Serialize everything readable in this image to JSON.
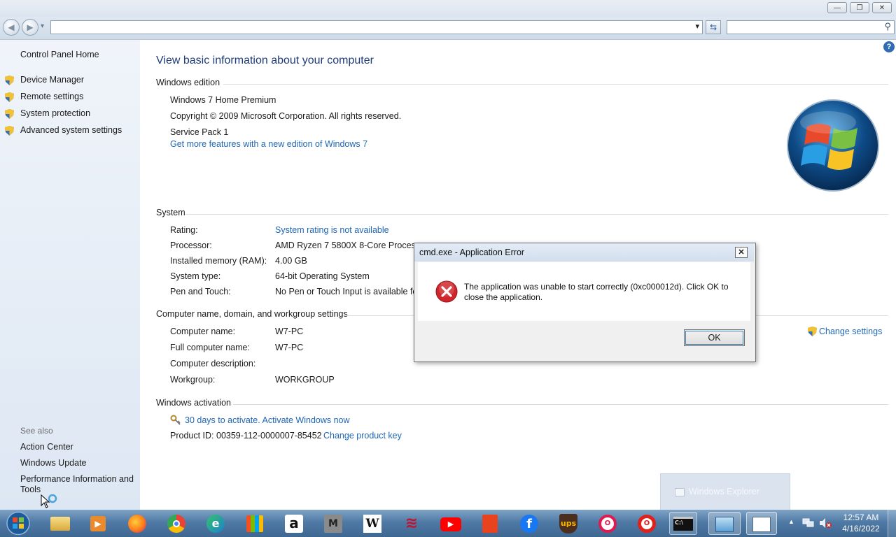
{
  "window": {
    "minimize_glyph": "—",
    "maximize_glyph": "❐",
    "close_glyph": "✕"
  },
  "navbar": {
    "back_glyph": "◀",
    "forward_glyph": "▶",
    "address_value": "",
    "search_value": "",
    "dropdown_glyph": "▾",
    "refresh_glyph": "⇆",
    "search_glyph": "⚲",
    "help_glyph": "?"
  },
  "sidebar": {
    "home": "Control Panel Home",
    "tasks": [
      "Device Manager",
      "Remote settings",
      "System protection",
      "Advanced system settings"
    ],
    "see_also_heading": "See also",
    "see_also": [
      "Action Center",
      "Windows Update",
      "Performance Information and",
      "Tools"
    ]
  },
  "main": {
    "title": "View basic information about your computer",
    "edition": {
      "heading": "Windows edition",
      "name": "Windows 7 Home Premium",
      "copyright": "Copyright © 2009 Microsoft Corporation.  All rights reserved.",
      "service_pack": "Service Pack 1",
      "upgrade_link": "Get more features with a new edition of Windows 7"
    },
    "system": {
      "heading": "System",
      "rows": [
        {
          "label": "Rating:",
          "value": "System rating is not available"
        },
        {
          "label": "Processor:",
          "value": "AMD Ryzen 7 5800X 8-Core Processor"
        },
        {
          "label": "Installed memory (RAM):",
          "value": "4.00 GB"
        },
        {
          "label": "System type:",
          "value": "64-bit Operating System"
        },
        {
          "label": "Pen and Touch:",
          "value": "No Pen or Touch Input is available fo"
        }
      ]
    },
    "computer": {
      "heading": "Computer name, domain, and workgroup settings",
      "change_settings": "Change settings",
      "rows": [
        {
          "label": "Computer name:",
          "value": "W7-PC"
        },
        {
          "label": "Full computer name:",
          "value": "W7-PC"
        },
        {
          "label": "Computer description:",
          "value": ""
        },
        {
          "label": "Workgroup:",
          "value": "WORKGROUP"
        }
      ]
    },
    "activation": {
      "heading": "Windows activation",
      "status_link": "30 days to activate. Activate Windows now",
      "product_id": "Product ID: 00359-112-0000007-85452",
      "change_key": "Change product key"
    }
  },
  "dialog": {
    "title": "cmd.exe - Application Error",
    "close_glyph": "✕",
    "message_line1": "The application was unable to start correctly (0xc000012d). Click OK to",
    "message_line2": "close the application.",
    "ok_label": "OK"
  },
  "toast": {
    "label": "Windows Explorer"
  },
  "taskbar": {
    "apps": [
      {
        "icon": "explorer-icon",
        "glyph": ""
      },
      {
        "icon": "media-player-icon",
        "glyph": "▶"
      },
      {
        "icon": "firefox-icon",
        "glyph": ""
      },
      {
        "icon": "chrome-icon",
        "glyph": ""
      },
      {
        "icon": "edge-icon",
        "glyph": "e"
      },
      {
        "icon": "store-icon",
        "glyph": ""
      },
      {
        "icon": "amazon-icon",
        "glyph": "a"
      },
      {
        "icon": "m-app-icon",
        "glyph": "M"
      },
      {
        "icon": "wikipedia-icon",
        "glyph": "W"
      },
      {
        "icon": "bank-icon",
        "glyph": "≋"
      },
      {
        "icon": "youtube-icon",
        "glyph": "▶"
      },
      {
        "icon": "office-icon",
        "glyph": ""
      },
      {
        "icon": "facebook-icon",
        "glyph": "f"
      },
      {
        "icon": "ups-icon",
        "glyph": "ups"
      },
      {
        "icon": "opera-gx-icon",
        "glyph": "O"
      },
      {
        "icon": "opera-icon",
        "glyph": "O"
      },
      {
        "icon": "cmd-icon",
        "glyph": "C:\\"
      },
      {
        "icon": "control-panel-icon",
        "glyph": ""
      },
      {
        "icon": "document-icon",
        "glyph": ""
      }
    ],
    "clock_time": "12:57 AM",
    "clock_date": "4/16/2022",
    "tray_arrow": "▲"
  },
  "colors": {
    "link": "#1f66b5",
    "title": "#1e3c78",
    "error_red": "#d0262b"
  }
}
